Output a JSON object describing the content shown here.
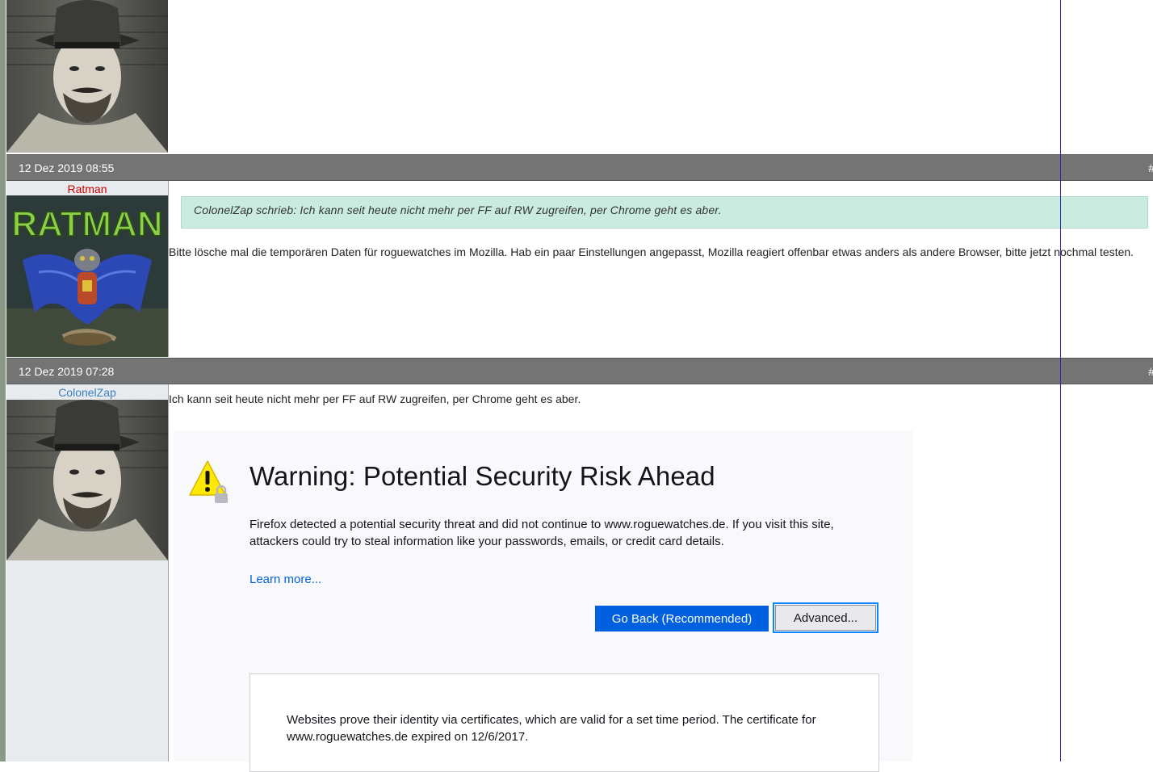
{
  "posts": [
    {
      "date": "12 Dez 2019 08:55",
      "hash": "#",
      "user": "Ratman",
      "user_color": "#cc0000",
      "avatar_text": "RATMAN",
      "quote": "ColonelZap schrieb: Ich kann seit heute nicht mehr per FF auf RW zugreifen, per Chrome geht es aber.",
      "text": "Bitte lösche mal die temporären Daten für roguewatches im Mozilla. Hab ein paar Einstellungen angepasst, Mozilla reagiert offenbar etwas anders als andere Browser, bitte jetzt nochmal testen."
    },
    {
      "date": "12 Dez 2019 07:28",
      "hash": "#",
      "user": "ColonelZap",
      "user_color": "#3a7fc0",
      "text": "Ich kann seit heute nicht mehr per FF auf RW zugreifen, per Chrome geht es aber."
    }
  ],
  "firefox_warning": {
    "title": "Warning: Potential Security Risk Ahead",
    "description": "Firefox detected a potential security threat and did not continue to www.roguewatches.de. If you visit this site, attackers could try to steal information like your passwords, emails, or credit card details.",
    "learn_more": "Learn more...",
    "go_back_button": "Go Back (Recommended)",
    "advanced_button": "Advanced...",
    "advanced_text": "Websites prove their identity via certificates, which are valid for a set time period. The certificate for www.roguewatches.de expired on 12/6/2017.",
    "icon": "warning-lock-icon"
  },
  "colors": {
    "header_bg": "#747474",
    "quote_bg": "#c9ebe0",
    "ff_primary": "#0060df"
  }
}
